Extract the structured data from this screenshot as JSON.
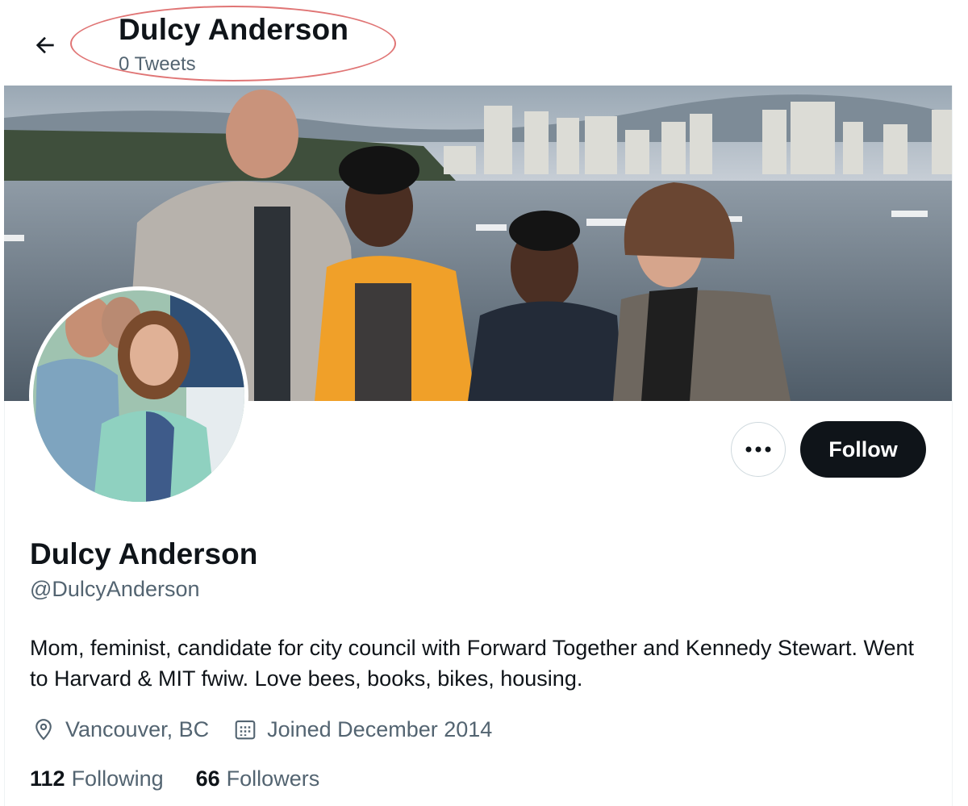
{
  "header": {
    "name": "Dulcy Anderson",
    "tweet_count": "0 Tweets"
  },
  "profile": {
    "display_name": "Dulcy Anderson",
    "handle": "@DulcyAnderson",
    "bio": "Mom, feminist, candidate for city council with Forward Together and Kennedy Stewart. Went to Harvard & MIT fwiw.  Love bees, books, bikes, housing.",
    "location": "Vancouver, BC",
    "joined": "Joined December 2014",
    "following_count": "112",
    "following_label": "Following",
    "followers_count": "66",
    "followers_label": "Followers"
  },
  "actions": {
    "follow_label": "Follow",
    "more_label": "•••"
  },
  "icons": {
    "back": "arrow-left-icon",
    "more": "more-dots-icon",
    "location": "location-pin-icon",
    "calendar": "calendar-icon"
  },
  "colors": {
    "text_primary": "#0f1419",
    "text_secondary": "#536471",
    "follow_bg": "#0f1419",
    "annotation_ring": "#e07575"
  }
}
